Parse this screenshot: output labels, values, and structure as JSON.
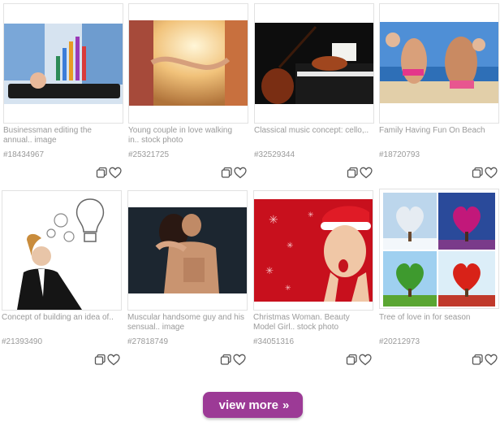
{
  "results": [
    {
      "caption": "Businessman editing the\nannual.. image",
      "id": "#18434967"
    },
    {
      "caption": "Young couple in love walking\nin.. stock photo",
      "id": "#25321725"
    },
    {
      "caption": "Classical music concept: cello,..",
      "id": "#32529344"
    },
    {
      "caption": "Family Having Fun On Beach",
      "id": "#18720793"
    },
    {
      "caption": "Concept of building an idea of..",
      "id": "#21393490"
    },
    {
      "caption": "Muscular handsome guy and his\nsensual.. image",
      "id": "#27818749"
    },
    {
      "caption": "Christmas Woman. Beauty\nModel Girl.. stock photo",
      "id": "#34051316"
    },
    {
      "caption": "Tree of love in for season",
      "id": "#20212973"
    }
  ],
  "view_more": {
    "label": "view more",
    "arrow": "»"
  },
  "icons": {
    "lightbox": "lightbox-icon",
    "favorite": "heart-icon"
  },
  "colors": {
    "accent": "#9c3a96",
    "text_muted": "#9a9a9a",
    "border": "#e2e2e2"
  }
}
